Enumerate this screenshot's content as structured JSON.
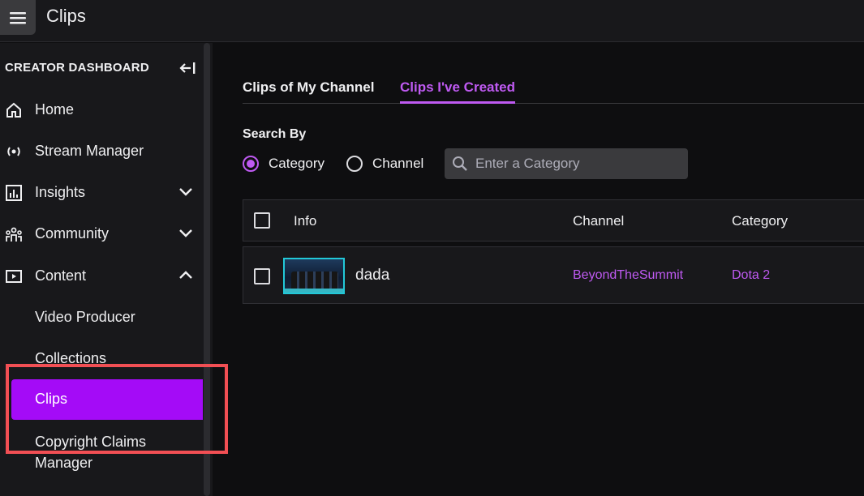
{
  "header": {
    "title": "Clips",
    "menu_icon": "hamburger-icon"
  },
  "sidebar": {
    "heading": "CREATOR DASHBOARD",
    "items": [
      {
        "label": "Home",
        "icon": "home-icon"
      },
      {
        "label": "Stream Manager",
        "icon": "broadcast-icon"
      },
      {
        "label": "Insights",
        "icon": "chart-icon",
        "expand": "chevron-down"
      },
      {
        "label": "Community",
        "icon": "community-icon",
        "expand": "chevron-down"
      },
      {
        "label": "Content",
        "icon": "content-icon",
        "expand": "chevron-up"
      },
      {
        "label": "Video Producer"
      },
      {
        "label": "Collections"
      },
      {
        "label": "Clips",
        "active": true
      },
      {
        "label_line1": "Copyright Claims",
        "label_line2": "Manager"
      }
    ]
  },
  "tabs": [
    {
      "label": "Clips of My Channel",
      "active": false
    },
    {
      "label": "Clips I've Created",
      "active": true
    }
  ],
  "search": {
    "label": "Search By",
    "options": [
      {
        "label": "Category",
        "selected": true
      },
      {
        "label": "Channel",
        "selected": false
      }
    ],
    "placeholder": "Enter a Category"
  },
  "table": {
    "columns": [
      "Info",
      "Channel",
      "Category"
    ],
    "rows": [
      {
        "title": "dada",
        "channel": "BeyondTheSummit",
        "category": "Dota 2"
      }
    ]
  },
  "colors": {
    "accent": "#bf5af2",
    "active_nav": "#a40bf7",
    "highlight": "#f24f54",
    "background": "#0e0e10",
    "panel": "#18181b"
  }
}
